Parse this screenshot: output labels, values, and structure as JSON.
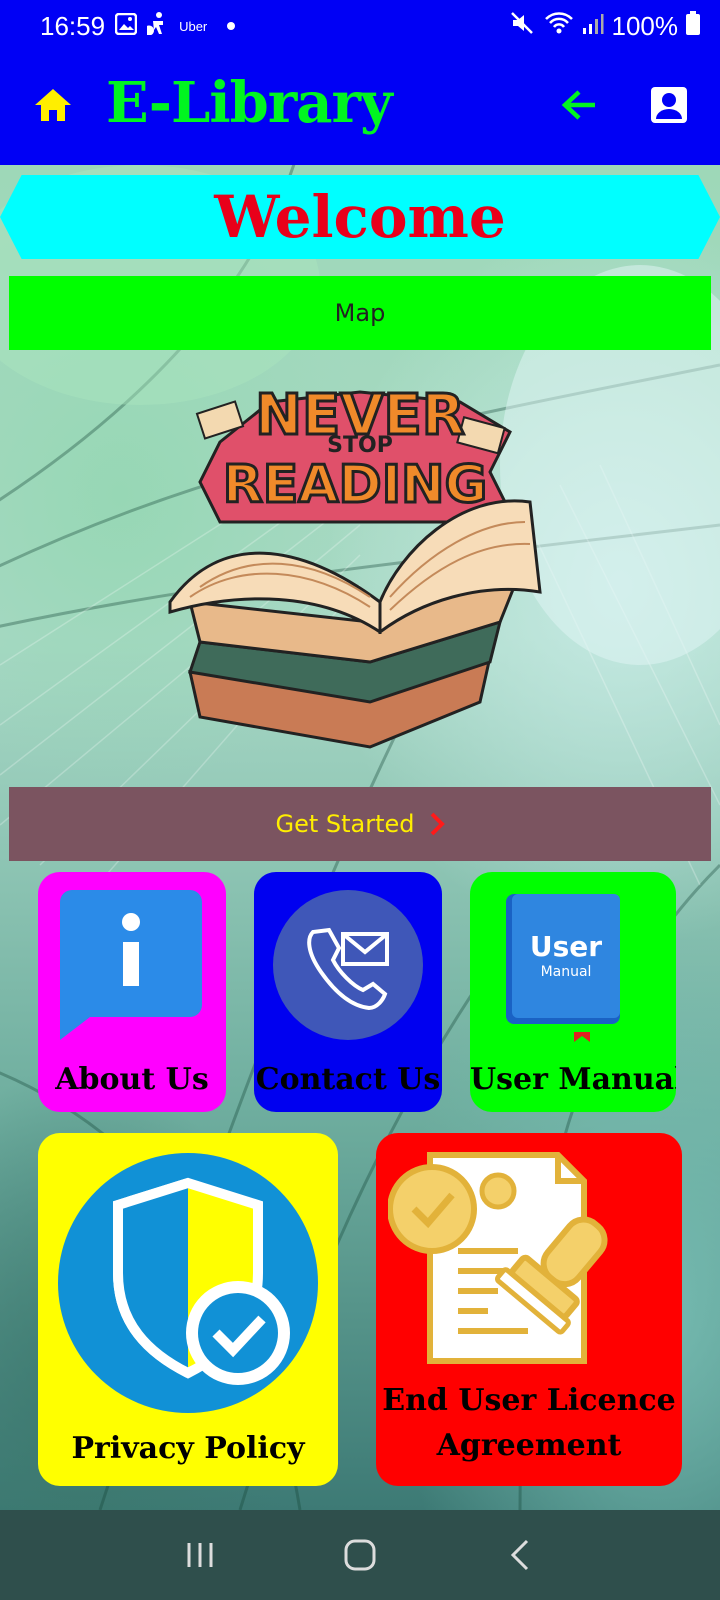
{
  "status": {
    "time": "16:59",
    "carrier_app": "Uber",
    "battery": "100%"
  },
  "app_bar": {
    "title": "E-Library"
  },
  "welcome": "Welcome",
  "map_button": "Map",
  "hero_image": {
    "line1": "NEVER",
    "line2": "STOP",
    "line3": "READING"
  },
  "get_started": "Get Started",
  "tiles": [
    {
      "label": "About Us",
      "icon": "info-icon"
    },
    {
      "label": "Contact Us",
      "icon": "phone-mail-icon"
    },
    {
      "label": "User Manual",
      "icon": "user-manual-book-icon",
      "icon_text": [
        "User",
        "Manual"
      ]
    },
    {
      "label": "Privacy Policy",
      "icon": "shield-check-icon"
    },
    {
      "label_lines": [
        "End User Licence",
        "Agreement"
      ],
      "icon": "license-document-icon"
    }
  ],
  "colors": {
    "app_bar": "#0000f5",
    "title": "#00f520",
    "welcome_bg": "#00ffff",
    "welcome_text": "#e8001a",
    "map_bg": "#00ff00",
    "get_started_bg": "#7b5460",
    "get_started_text": "#ffee00"
  }
}
